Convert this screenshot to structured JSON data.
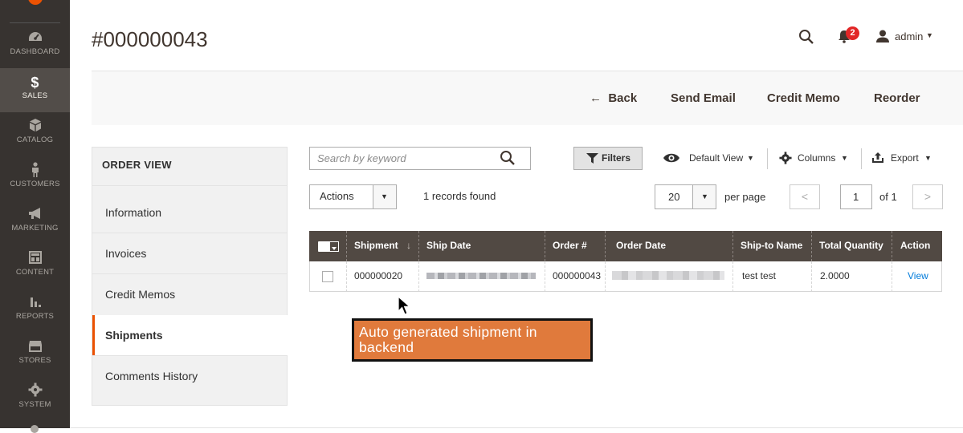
{
  "sidebar": {
    "items": [
      {
        "label": "DASHBOARD",
        "icon": "dashboard-icon"
      },
      {
        "label": "SALES",
        "icon": "dollar-icon"
      },
      {
        "label": "CATALOG",
        "icon": "cube-icon"
      },
      {
        "label": "CUSTOMERS",
        "icon": "person-icon"
      },
      {
        "label": "MARKETING",
        "icon": "megaphone-icon"
      },
      {
        "label": "CONTENT",
        "icon": "content-icon"
      },
      {
        "label": "REPORTS",
        "icon": "bar-chart-icon"
      },
      {
        "label": "STORES",
        "icon": "store-icon"
      },
      {
        "label": "SYSTEM",
        "icon": "gear-icon"
      }
    ],
    "active": "SALES",
    "accent": "#eb5202"
  },
  "header": {
    "title": "#000000043",
    "notifications_count": "2",
    "user": "admin"
  },
  "actionbar": {
    "back": "Back",
    "send_email": "Send Email",
    "credit_memo": "Credit Memo",
    "reorder": "Reorder"
  },
  "order_view": {
    "heading": "ORDER VIEW",
    "items": [
      "Information",
      "Invoices",
      "Credit Memos",
      "Shipments",
      "Comments History"
    ],
    "active": "Shipments"
  },
  "toolbar": {
    "search_placeholder": "Search by keyword",
    "filters": "Filters",
    "default_view": "Default View",
    "columns": "Columns",
    "export": "Export",
    "actions": "Actions",
    "records_found": "1 records found",
    "per_page_value": "20",
    "per_page_label": "per page",
    "page_value": "1",
    "page_of": "of 1"
  },
  "grid": {
    "columns": [
      "Shipment",
      "Ship Date",
      "Order #",
      "Order Date",
      "Ship-to Name",
      "Total Quantity",
      "Action"
    ],
    "sort_indicator": "↓",
    "rows": [
      {
        "shipment": "000000020",
        "order": "000000043",
        "ship_to": "test test",
        "qty": "2.0000",
        "action": "View"
      }
    ]
  },
  "annotation": {
    "text": "Auto generated shipment in backend",
    "color": "#e07a3c"
  }
}
